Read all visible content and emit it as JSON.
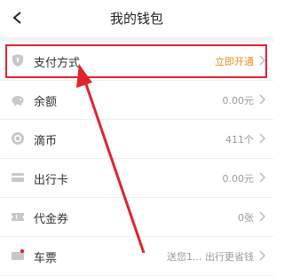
{
  "header": {
    "title": "我的钱包"
  },
  "items": [
    {
      "label": "支付方式",
      "value": "立即开通",
      "accent": "#f08a24"
    },
    {
      "label": "余额",
      "value": "0.00元"
    },
    {
      "label": "滴币",
      "value": "411个"
    },
    {
      "label": "出行卡",
      "value": "0.00元"
    },
    {
      "label": "代金券",
      "value": "0张"
    },
    {
      "label": "车票",
      "value": "送您1... 出行更省钱"
    }
  ],
  "colors": {
    "highlight": "#e2232a",
    "accent": "#f08a24",
    "icon": "#c8c8c8"
  },
  "icons": [
    "back-icon",
    "shield-icon",
    "piggy-bank-icon",
    "coin-icon",
    "card-icon",
    "voucher-icon",
    "ticket-icon",
    "chevron-right-icon"
  ]
}
